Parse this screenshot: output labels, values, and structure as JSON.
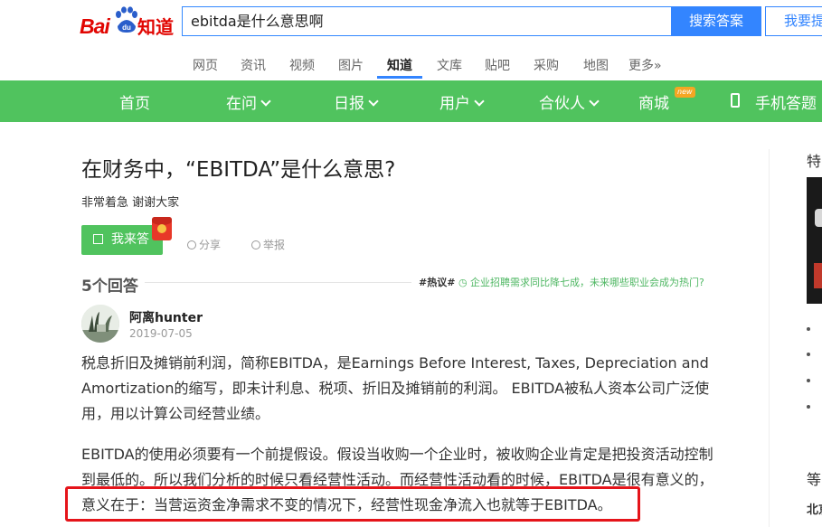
{
  "brand": {
    "logo_latin": "Bai",
    "logo_du": "du",
    "logo_cn": "知道",
    "color": "#e10602"
  },
  "search": {
    "query": "ebitda是什么意思啊",
    "button": "搜索答案",
    "ask_button": "我要提问"
  },
  "top_nav": {
    "items": [
      "网页",
      "资讯",
      "视频",
      "图片",
      "知道",
      "文库",
      "贴吧",
      "采购",
      "地图",
      "更多»"
    ],
    "active": "知道"
  },
  "green_nav": {
    "color": "#50c35e",
    "items": [
      "首页",
      "在问",
      "日报",
      "用户",
      "合伙人",
      "商城",
      "手机答题"
    ],
    "new_badge": "new"
  },
  "question": {
    "title": "在财务中，“EBITDA”是什么意思?",
    "description": "非常着急 谢谢大家",
    "answer_button": "我来答",
    "share": "分享",
    "report": "举报"
  },
  "answers": {
    "count_label": "5个回答",
    "hot_tag": "#热议#",
    "hot_text": "企业招聘需求同比降七成，未来哪些职业会成为热门?"
  },
  "answer": {
    "user": "阿离hunter",
    "date": "2019-07-05",
    "p1": "税息折旧及摊销前利润，简称EBITDA，是Earnings Before Interest, Taxes, Depreciation and Amortization的缩写，即未计利息、税项、折旧及摊销前的利润。 EBITDA被私人资本公司广泛使用，用以计算公司经营业绩。",
    "p2": "EBITDA的使用必须要有一个前提假设。假设当收购一个企业时，被收购企业肯定是把投资活动控制到最低的。所以我们分析的时候只看经营性活动。而经营性活动看的时候，EBITDA是很有意义的，意义在于：当营运资金净需求不变的情况下，经营性现金净流入也就等于EBITDA。"
  },
  "sidebar": {
    "title": "特",
    "section2": "等",
    "text3": "北京"
  }
}
